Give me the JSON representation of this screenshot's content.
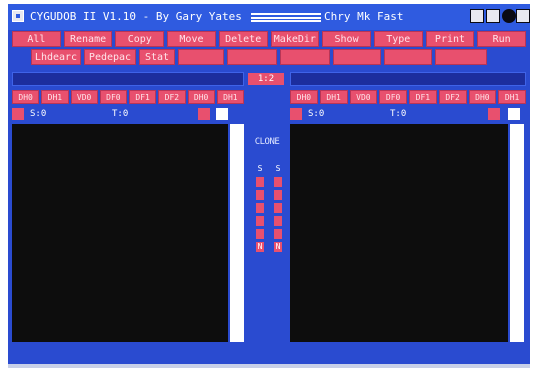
{
  "window": {
    "title": "CYGUDOB II V1.10  -  By Gary Yates",
    "title_right": "Chry  Mk Fast"
  },
  "toolbar_row1": [
    "All",
    "Rename",
    "Copy",
    "Move",
    "Delete",
    "MakeDir",
    "Show",
    "Type",
    "Print",
    "Run"
  ],
  "toolbar_row2": [
    "Lhdearc",
    "Pedepac",
    "Stat",
    "",
    "",
    "",
    "",
    "",
    ""
  ],
  "middle": {
    "pill": "1:2",
    "clone_label": "CLONE",
    "left_column": [
      "S",
      "",
      "",
      "",
      "",
      "",
      "N"
    ],
    "right_column": [
      "S",
      "",
      "",
      "",
      "",
      "",
      "N"
    ]
  },
  "left_panel": {
    "drives": [
      "DH0",
      "DH1",
      "VD0",
      "DF0",
      "DF1",
      "DF2",
      "DH0",
      "DH1"
    ],
    "status_left": "S:0",
    "status_right": "T:0"
  },
  "right_panel": {
    "drives": [
      "DH0",
      "DH1",
      "VD0",
      "DF0",
      "DF1",
      "DF2",
      "DH0",
      "DH1"
    ],
    "status_left": "S:0",
    "status_right": "T:0"
  }
}
